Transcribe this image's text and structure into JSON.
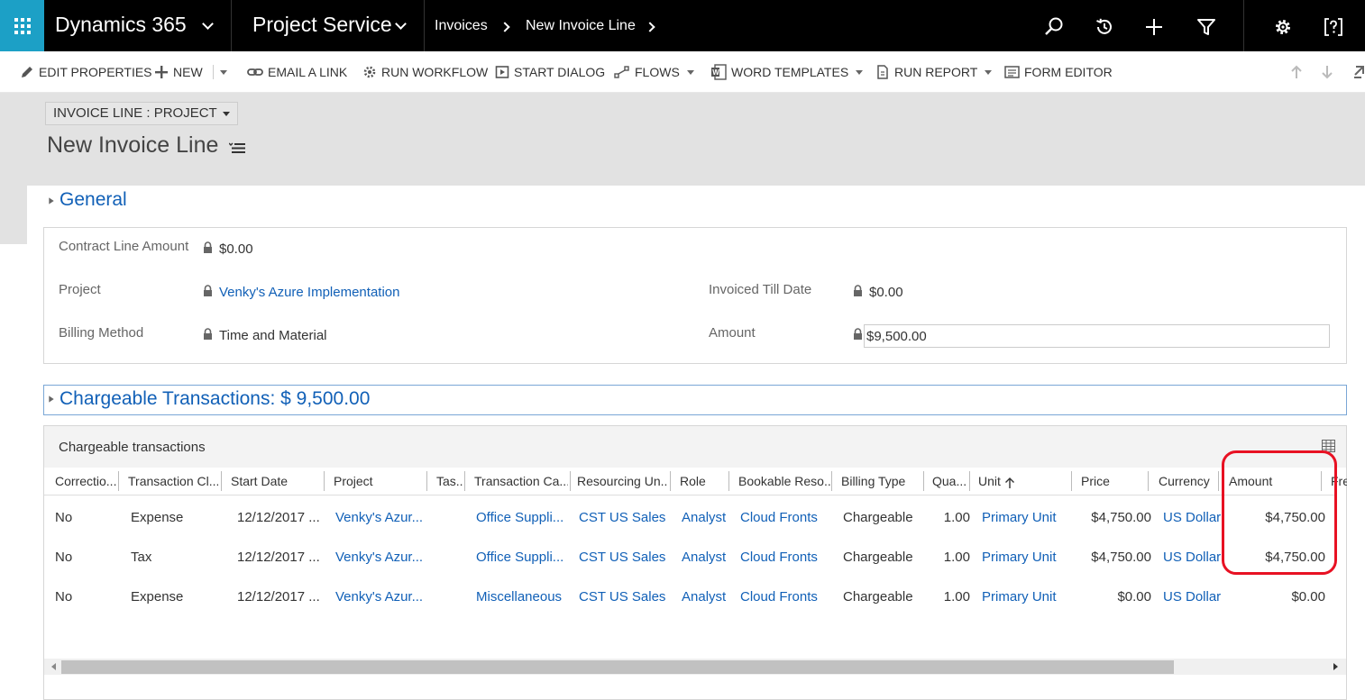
{
  "nav": {
    "brand": "Dynamics 365",
    "area": "Project Service",
    "breadcrumbs": [
      "Invoices",
      "New Invoice Line"
    ]
  },
  "commands": {
    "edit_properties": "EDIT PROPERTIES",
    "new": "NEW",
    "email_link": "EMAIL A LINK",
    "run_workflow": "RUN WORKFLOW",
    "start_dialog": "START DIALOG",
    "flows": "FLOWS",
    "word_templates": "WORD TEMPLATES",
    "run_report": "RUN REPORT",
    "form_editor": "FORM EDITOR"
  },
  "header": {
    "form_selector": "INVOICE LINE : PROJECT",
    "record_title": "New Invoice Line"
  },
  "general": {
    "title": "General",
    "contract_line_amount_label": "Contract Line Amount",
    "contract_line_amount": "$0.00",
    "project_label": "Project",
    "project": "Venky's Azure Implementation",
    "billing_method_label": "Billing Method",
    "billing_method": "Time and Material",
    "invoiced_till_date_label": "Invoiced Till Date",
    "invoiced_till_date": "$0.00",
    "amount_label": "Amount",
    "amount": "$9,500.00"
  },
  "chargeable": {
    "section_title": "Chargeable Transactions: $ 9,500.00",
    "grid_title": "Chargeable transactions",
    "columns": [
      "Correctio...",
      "Transaction Cl...",
      "Start Date",
      "Project",
      "Tas...",
      "Transaction Ca...",
      "Resourcing Un...",
      "Role",
      "Bookable Reso...",
      "Billing Type",
      "Qua...",
      "Unit",
      "Price",
      "Currency",
      "Amount",
      "Fre"
    ],
    "rows": [
      [
        "No",
        "Expense",
        "12/12/2017 ...",
        "Venky's Azur...",
        "",
        "Office Suppli...",
        "CST US Sales",
        "Analyst",
        "Cloud Fronts",
        "Chargeable",
        "1.00",
        "Primary Unit",
        "$4,750.00",
        "US Dollar",
        "$4,750.00"
      ],
      [
        "No",
        "Tax",
        "12/12/2017 ...",
        "Venky's Azur...",
        "",
        "Office Suppli...",
        "CST US Sales",
        "Analyst",
        "Cloud Fronts",
        "Chargeable",
        "1.00",
        "Primary Unit",
        "$4,750.00",
        "US Dollar",
        "$4,750.00"
      ],
      [
        "No",
        "Expense",
        "12/12/2017 ...",
        "Venky's Azur...",
        "",
        "Miscellaneous",
        "CST US Sales",
        "Analyst",
        "Cloud Fronts",
        "Chargeable",
        "1.00",
        "Primary Unit",
        "$0.00",
        "US Dollar",
        "$0.00"
      ]
    ]
  },
  "colors": {
    "accent": "#1ca0c6",
    "link": "#1160b7",
    "highlight": "#e81123"
  }
}
